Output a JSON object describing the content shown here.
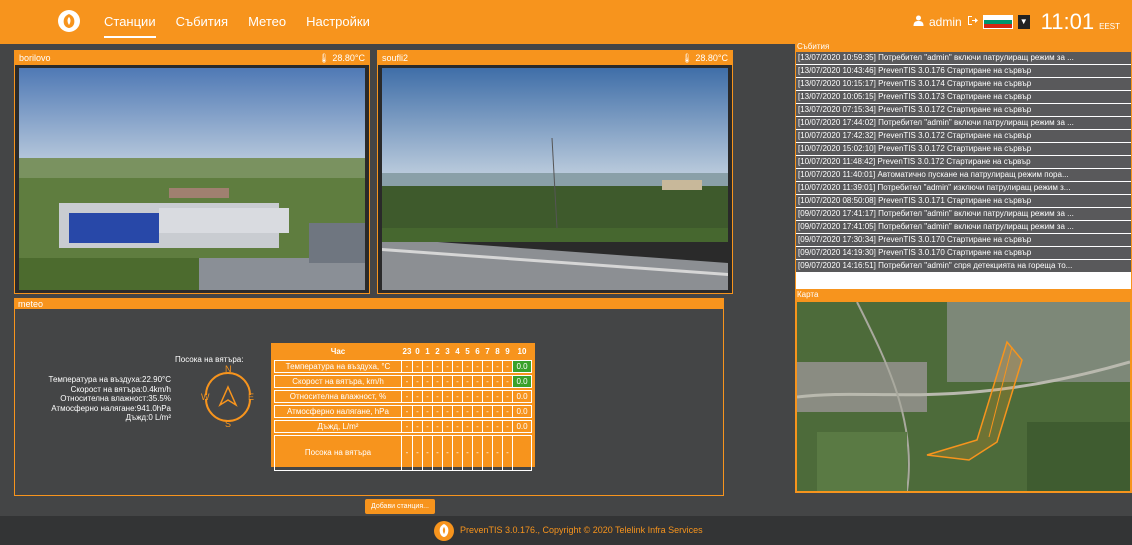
{
  "nav": {
    "items": [
      {
        "label": "Станции",
        "active": true
      },
      {
        "label": "Събития",
        "active": false
      },
      {
        "label": "Метео",
        "active": false
      },
      {
        "label": "Настройки",
        "active": false
      }
    ],
    "user": "admin",
    "time": "11:01",
    "timezone": "EEST",
    "icons": {
      "user": "user-icon",
      "logout": "logout-icon",
      "language": "bulgarian-flag-icon"
    }
  },
  "cameras": [
    {
      "name": "borilovo",
      "temperature": "28.80°C"
    },
    {
      "name": "soufli2",
      "temperature": "28.80°C"
    }
  ],
  "events": {
    "title": "Събития",
    "items": [
      "[13/07/2020 10:59:35] Потребител \"admin\" включи патрулиращ режим за ...",
      "[13/07/2020 10:43:46] PrevenTIS 3.0.176 Стартиране на сървър",
      "[13/07/2020 10:15:17] PrevenTIS 3.0.174 Стартиране на сървър",
      "[13/07/2020 10:05:15] PrevenTIS 3.0.173 Стартиране на сървър",
      "[13/07/2020 07:15:34] PrevenTIS 3.0.172 Стартиране на сървър",
      "[10/07/2020 17:44:02] Потребител \"admin\" включи патрулиращ режим за ...",
      "[10/07/2020 17:42:32] PrevenTIS 3.0.172 Стартиране на сървър",
      "[10/07/2020 15:02:10] PrevenTIS 3.0.172 Стартиране на сървър",
      "[10/07/2020 11:48:42] PrevenTIS 3.0.172 Стартиране на сървър",
      "[10/07/2020 11:40:01] Автоматично пускане на патрулиращ режим пора...",
      "[10/07/2020 11:39:01] Потребител \"admin\" изключи патрулиращ режим з...",
      "[10/07/2020 08:50:08] PrevenTIS 3.0.171 Стартиране на сървър",
      "[09/07/2020 17:41:17] Потребител \"admin\" включи патрулиращ режим за ...",
      "[09/07/2020 17:41:05] Потребител \"admin\" включи патрулиращ режим за ...",
      "[09/07/2020 17:30:34] PrevenTIS 3.0.170 Стартиране на сървър",
      "[09/07/2020 14:19:30] PrevenTIS 3.0.170 Стартиране на сървър",
      "[09/07/2020 14:16:51] Потребител \"admin\" спря детекцията на гореща то..."
    ]
  },
  "map": {
    "title": "Карта"
  },
  "meteo": {
    "title": "meteo",
    "readings": [
      "Температура на въздуха:22.90°C",
      "Скорост на вятъра:0.4km/h",
      "Относителна влажност:35.5%",
      "Атмосферно налягане:941.0hPa",
      "Дъжд:0 L/m²"
    ],
    "wind_direction_label": "Посока на вятъра:",
    "compass": {
      "n": "N",
      "s": "S",
      "e": "E",
      "w": "W"
    },
    "table": {
      "header": "Час",
      "hours": [
        "23",
        "0",
        "1",
        "2",
        "3",
        "4",
        "5",
        "6",
        "7",
        "8",
        "9",
        "10"
      ],
      "rows": [
        {
          "label": "Температура на въздуха, °C",
          "cells": [
            "-",
            "-",
            "-",
            "-",
            "-",
            "-",
            "-",
            "-",
            "-",
            "-",
            "-",
            "0.0"
          ],
          "highlight_last": true
        },
        {
          "label": "Скорост на вятъра, km/h",
          "cells": [
            "-",
            "-",
            "-",
            "-",
            "-",
            "-",
            "-",
            "-",
            "-",
            "-",
            "-",
            "0.0"
          ],
          "highlight_last": true
        },
        {
          "label": "Относителна влажност, %",
          "cells": [
            "-",
            "-",
            "-",
            "-",
            "-",
            "-",
            "-",
            "-",
            "-",
            "-",
            "-",
            "0.0"
          ],
          "highlight_last": false
        },
        {
          "label": "Атмосферно налягане, hPa",
          "cells": [
            "-",
            "-",
            "-",
            "-",
            "-",
            "-",
            "-",
            "-",
            "-",
            "-",
            "-",
            "0.0"
          ],
          "highlight_last": false
        },
        {
          "label": "Дъжд, L/m²",
          "cells": [
            "-",
            "-",
            "-",
            "-",
            "-",
            "-",
            "-",
            "-",
            "-",
            "-",
            "-",
            "0.0"
          ],
          "highlight_last": false
        },
        {
          "label": "Посока на вятъра",
          "cells": [
            "-",
            "-",
            "-",
            "-",
            "-",
            "-",
            "-",
            "-",
            "-",
            "-",
            "-",
            ""
          ],
          "highlight_last": false
        }
      ]
    }
  },
  "add_station_label": "Добави станция...",
  "footer": "PrevenTIS 3.0.176., Copyright © 2020 Telelink Infra Services",
  "colors": {
    "accent": "#f7941d",
    "background": "#444546",
    "footer": "#333435",
    "green": "#3aa12a"
  }
}
